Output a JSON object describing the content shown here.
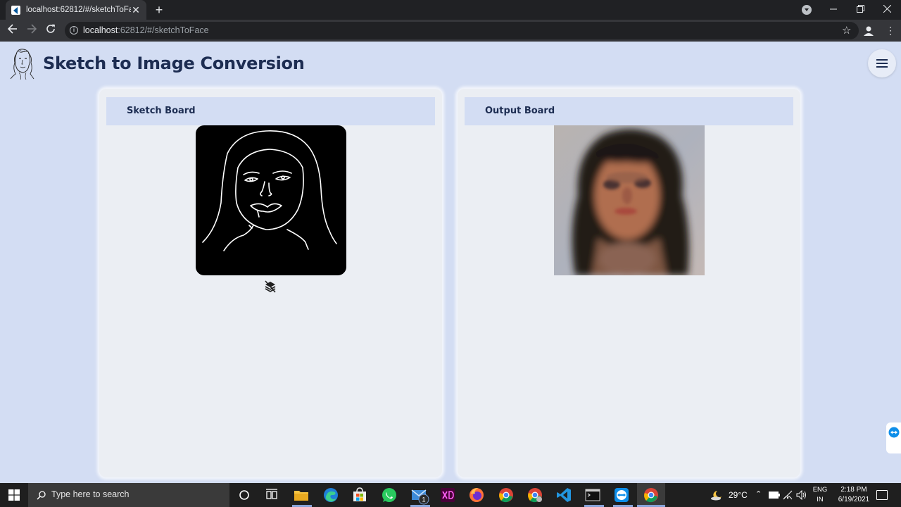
{
  "browser": {
    "tab_title": "localhost:62812/#/sketchToFace",
    "url_host": "localhost",
    "url_path": ":62812/#/sketchToFace"
  },
  "app": {
    "title": "Sketch to Image Conversion"
  },
  "boards": {
    "sketch_title": "Sketch Board",
    "output_title": "Output Board"
  },
  "taskbar": {
    "search_placeholder": "Type here to search",
    "mail_badge": "1",
    "temperature": "29°C",
    "lang_line1": "ENG",
    "lang_line2": "IN",
    "time": "2:18 PM",
    "date": "6/19/2021"
  }
}
